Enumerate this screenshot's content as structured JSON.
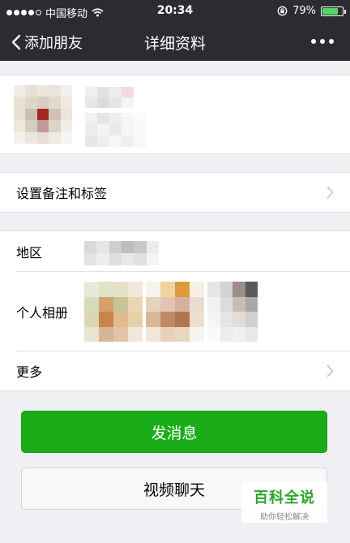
{
  "status_bar": {
    "carrier": "中国移动",
    "time": "20:34",
    "battery": "79%",
    "battery_level": 0.79
  },
  "nav": {
    "back_label": "添加朋友",
    "title": "详细资料"
  },
  "rows": {
    "remark": "设置备注和标签",
    "region": "地区",
    "album": "个人相册",
    "more": "更多"
  },
  "buttons": {
    "message": "发消息",
    "video": "视频聊天"
  },
  "watermark": {
    "title": "百科全说",
    "subtitle": "助你轻松解决"
  },
  "colors": {
    "nav_bg": "#2c2c30",
    "primary_green": "#1aad19",
    "page_bg": "#efeff4"
  },
  "icons": {
    "back": "chevron-left-icon",
    "more": "more-dots-icon",
    "row_arrow": "chevron-right-icon"
  }
}
